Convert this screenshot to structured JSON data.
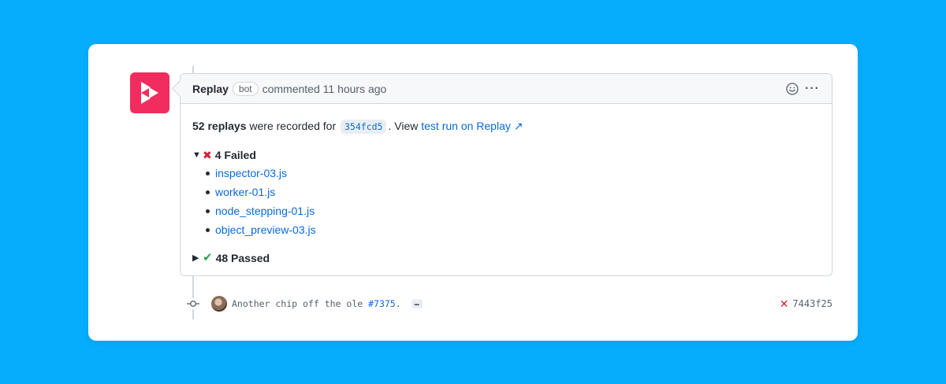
{
  "comment": {
    "author": "Replay",
    "badge": "bot",
    "action": "commented 11 hours ago",
    "summary": {
      "count": "52 replays",
      "text_mid": "were recorded for",
      "sha": "354fcd5",
      "text_after": ". View",
      "link_label": "test run on Replay ↗"
    },
    "failed": {
      "label": "4 Failed",
      "expanded": true,
      "items": [
        "inspector-03.js",
        "worker-01.js",
        "node_stepping-01.js",
        "object_preview-03.js"
      ]
    },
    "passed": {
      "label": "48 Passed",
      "expanded": false
    }
  },
  "commit": {
    "message": "Another chip off the ole ",
    "pr_link": "#7375",
    "message_end": ".",
    "ellipsis": "…",
    "sha": "7443f25",
    "status": "failed"
  },
  "colors": {
    "background": "#05adfc",
    "brand": "#f02d5e",
    "link": "#0969da",
    "fail": "#cf222e",
    "pass": "#2da44e"
  },
  "icons": [
    "replay-logo-icon",
    "smiley-icon",
    "kebab-icon",
    "x-icon",
    "check-icon",
    "commit-icon"
  ]
}
